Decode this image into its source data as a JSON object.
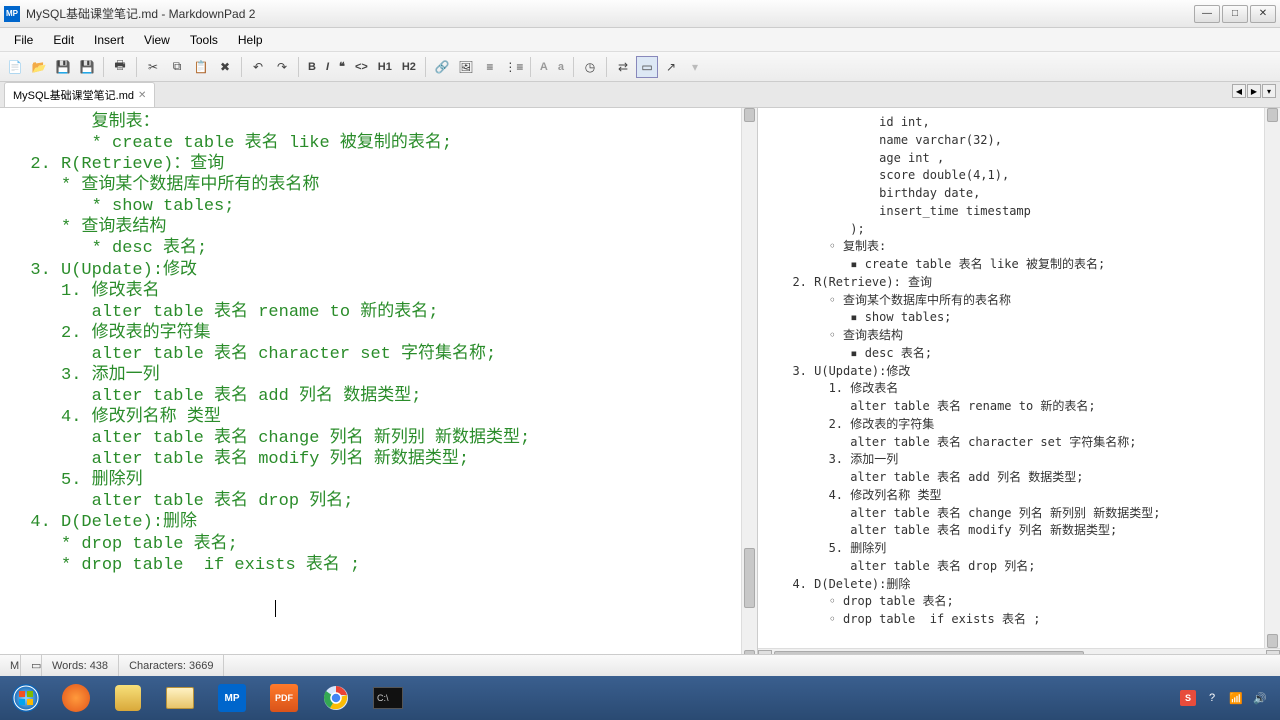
{
  "window": {
    "title": "MySQL基础课堂笔记.md - MarkdownPad 2",
    "app_badge": "MP"
  },
  "menu": {
    "file": "File",
    "edit": "Edit",
    "insert": "Insert",
    "view": "View",
    "tools": "Tools",
    "help": "Help"
  },
  "toolbar": {
    "h1": "H1",
    "h2": "H2",
    "a_upper": "A",
    "a_lower": "a"
  },
  "tab": {
    "name": "MySQL基础课堂笔记.md"
  },
  "editor": {
    "content": "        复制表：\n        * create table 表名 like 被复制的表名;\n  2. R(Retrieve)：查询\n     * 查询某个数据库中所有的表名称\n        * show tables;\n     * 查询表结构\n        * desc 表名;\n  3. U(Update):修改\n     1. 修改表名\n        alter table 表名 rename to 新的表名;\n     2. 修改表的字符集\n        alter table 表名 character set 字符集名称;\n     3. 添加一列\n        alter table 表名 add 列名 数据类型;\n     4. 修改列名称 类型\n        alter table 表名 change 列名 新列别 新数据类型;\n        alter table 表名 modify 列名 新数据类型;\n     5. 删除列\n        alter table 表名 drop 列名;\n  4. D(Delete):删除\n     * drop table 表名;\n     * drop table  if exists 表名 ;\n\n                          "
  },
  "preview": {
    "content": "              id int,\n              name varchar(32),\n              age int ,\n              score double(4,1),\n              birthday date,\n              insert_time timestamp\n          );\n       ◦ 复制表:\n          ▪ create table 表名 like 被复制的表名;\n  2. R(Retrieve): 查询\n       ◦ 查询某个数据库中所有的表名称\n          ▪ show tables;\n       ◦ 查询表结构\n          ▪ desc 表名;\n  3. U(Update):修改\n       1. 修改表名\n          alter table 表名 rename to 新的表名;\n       2. 修改表的字符集\n          alter table 表名 character set 字符集名称;\n       3. 添加一列\n          alter table 表名 add 列名 数据类型;\n       4. 修改列名称 类型\n          alter table 表名 change 列名 新列别 新数据类型;\n          alter table 表名 modify 列名 新数据类型;\n       5. 删除列\n          alter table 表名 drop 列名;\n  4. D(Delete):删除\n       ◦ drop table 表名;\n       ◦ drop table  if exists 表名 ;"
  },
  "status": {
    "words_label": "Words: 438",
    "chars_label": "Characters: 3669"
  },
  "tray": {
    "ime": "S"
  }
}
